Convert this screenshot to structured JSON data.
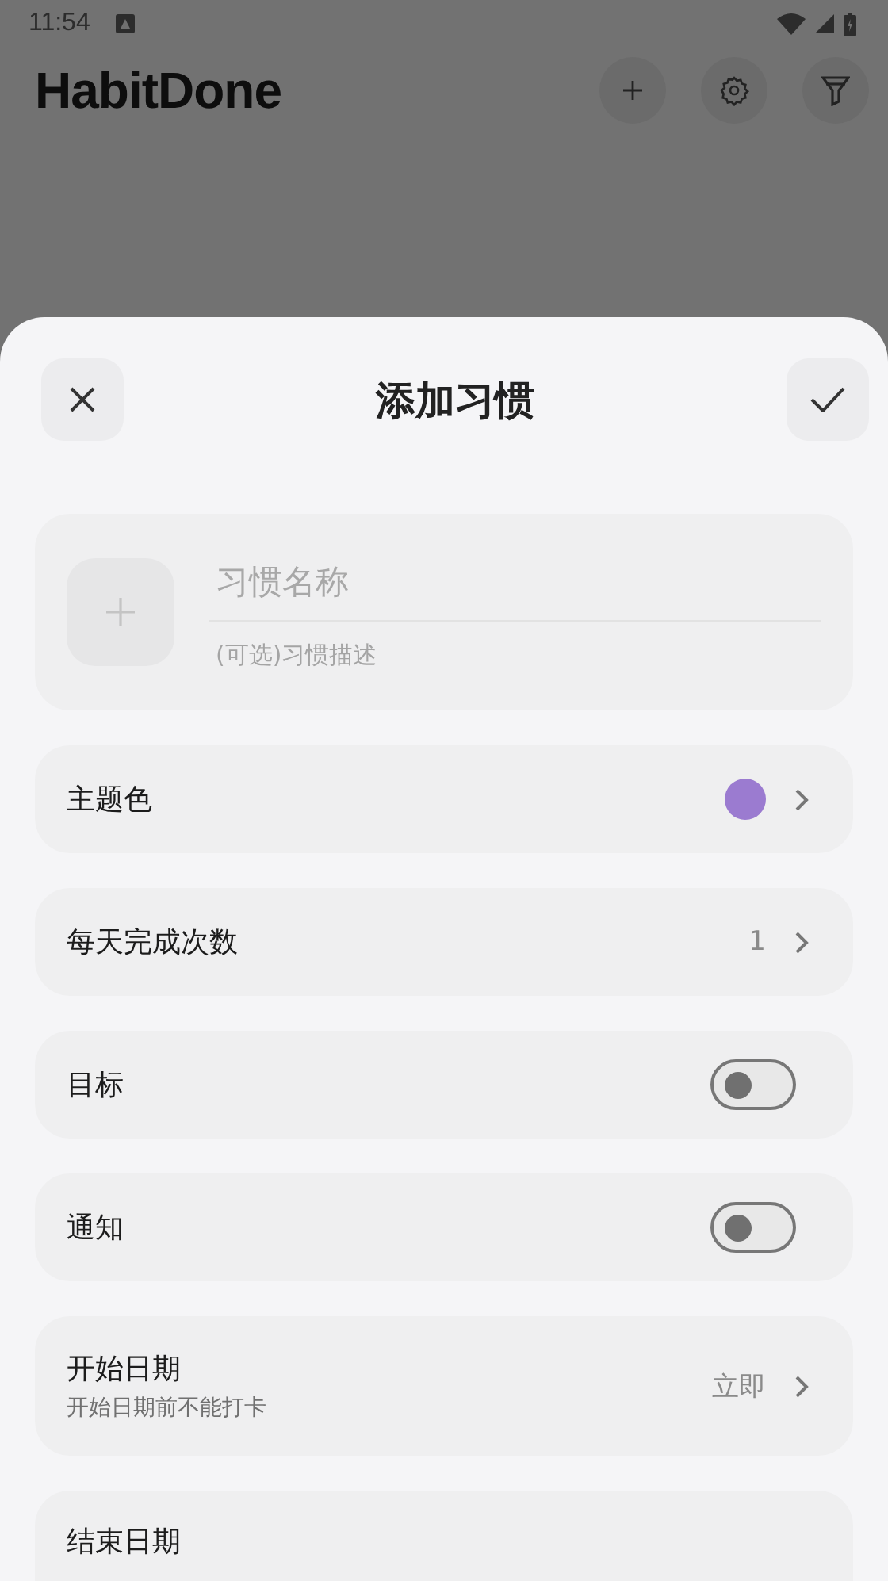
{
  "status_bar": {
    "time": "11:54"
  },
  "app_bar": {
    "title": "HabitDone"
  },
  "sheet": {
    "title": "添加习惯",
    "name_field": {
      "placeholder": "习惯名称"
    },
    "description_field": {
      "placeholder": "(可选)习惯描述"
    },
    "settings": [
      {
        "kind": "color",
        "label": "主题色",
        "color": "#9b7bd0"
      },
      {
        "kind": "value",
        "label": "每天完成次数",
        "value": "1"
      },
      {
        "kind": "toggle",
        "label": "目标",
        "on": false
      },
      {
        "kind": "toggle",
        "label": "通知",
        "on": false
      },
      {
        "kind": "value",
        "label": "开始日期",
        "subtitle": "开始日期前不能打卡",
        "value": "立即"
      },
      {
        "kind": "cut",
        "label": "结束日期"
      }
    ]
  }
}
